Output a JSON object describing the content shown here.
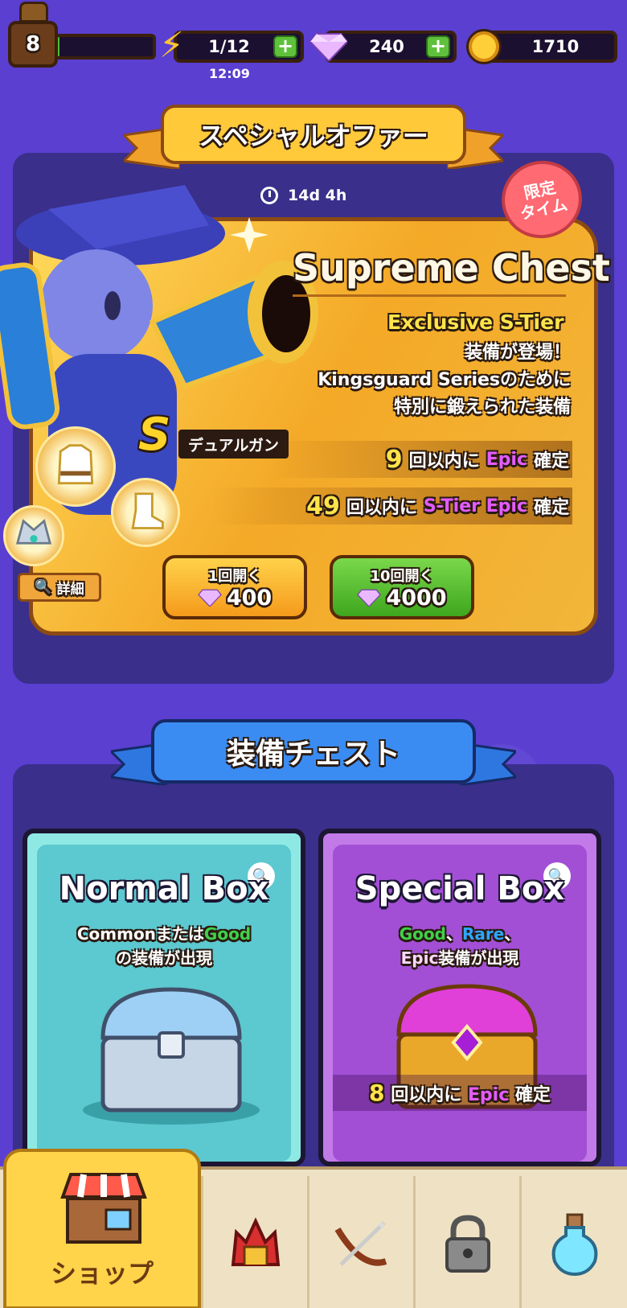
{
  "header": {
    "level": "8",
    "xp_progress": 0.02,
    "energy": "1/12",
    "energy_timer": "12:09",
    "gems": "240",
    "coins": "1710"
  },
  "special_offer": {
    "banner": "スペシャルオファー",
    "countdown": "14d 4h",
    "limited_badge_line1": "限定",
    "limited_badge_line2": "タイム",
    "title": "Supreme Chest",
    "exclusive": "Exclusive S-Tier",
    "desc_line1": "装備が登場！",
    "desc_line2": "Kingsguard Seriesのために",
    "desc_line3": "特別に鍛えられた装備",
    "weapon_tier": "S",
    "weapon_name": "デュアルガン",
    "guarantee1": {
      "num": "9",
      "pre": "回以内に",
      "rarity": "Epic",
      "post": "確定"
    },
    "guarantee2": {
      "num": "49",
      "pre": "回以内に",
      "rarity": "S-Tier Epic",
      "post": "確定"
    },
    "detail_label": "詳細",
    "open1_label": "1回開く",
    "open1_cost": "400",
    "open10_label": "10回開く",
    "open10_cost": "4000"
  },
  "equipment": {
    "banner": "装備チェスト",
    "normal": {
      "title": "Normal Box",
      "desc_common": "Common",
      "desc_or": "または",
      "desc_good": "Good",
      "desc_line2": "の装備が出現"
    },
    "special": {
      "title": "Special Box",
      "desc_good": "Good",
      "desc_sep1": "、",
      "desc_rare": "Rare",
      "desc_sep2": "、",
      "desc_epic": "Epic",
      "desc_line2": "装備が出現",
      "guarantee_num": "8",
      "guarantee_pre": "回以内に",
      "guarantee_rarity": "Epic",
      "guarantee_post": "確定"
    }
  },
  "nav": {
    "shop_label": "ショップ",
    "tabs": [
      "shop-icon",
      "helmet-icon",
      "crossbow-icon",
      "lock-icon",
      "potion-icon"
    ]
  },
  "colors": {
    "background": "#5a3fd1",
    "gold": "#ffd95a",
    "epic": "#e35cff",
    "good": "#3fd14a",
    "rare": "#2ea7ff"
  }
}
